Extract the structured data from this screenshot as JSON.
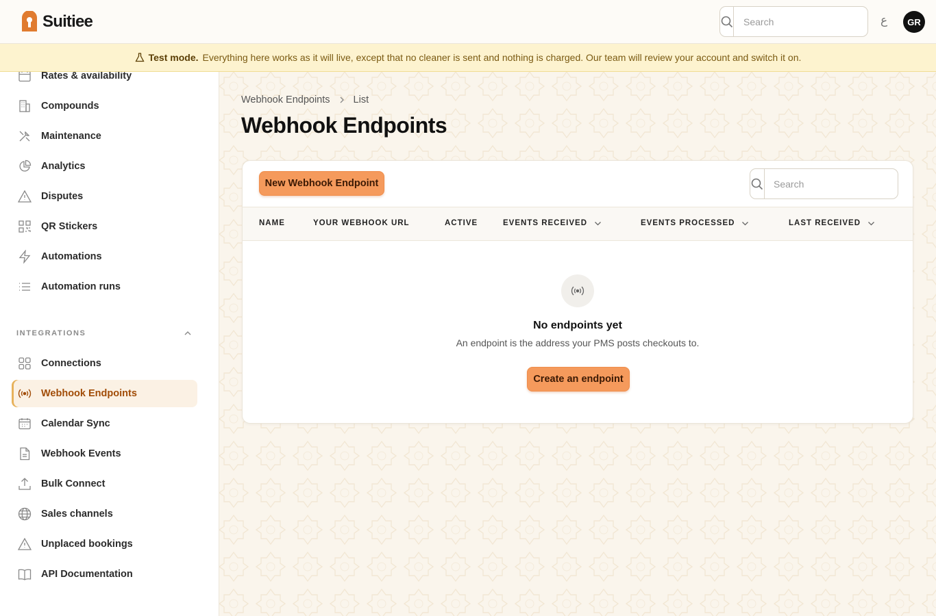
{
  "app": {
    "name": "Suitiee"
  },
  "topbar": {
    "search_placeholder": "Search",
    "lang_glyph": "ع",
    "avatar_initials": "GR"
  },
  "banner": {
    "label": "Test mode.",
    "message": "Everything here works as it will live, except that no cleaner is sent and nothing is charged. Our team will review your account and switch it on."
  },
  "sidebar": {
    "items_top": [
      {
        "label": "Rates & availability",
        "icon": "calendar-icon"
      },
      {
        "label": "Compounds",
        "icon": "building-icon"
      },
      {
        "label": "Maintenance",
        "icon": "tools-icon"
      },
      {
        "label": "Analytics",
        "icon": "pie-chart-icon"
      },
      {
        "label": "Disputes",
        "icon": "warning-icon"
      },
      {
        "label": "QR Stickers",
        "icon": "qr-code-icon"
      },
      {
        "label": "Automations",
        "icon": "bolt-icon"
      },
      {
        "label": "Automation runs",
        "icon": "list-icon"
      }
    ],
    "section_label": "INTEGRATIONS",
    "items_integrations": [
      {
        "label": "Connections",
        "icon": "grid-icon"
      },
      {
        "label": "Webhook Endpoints",
        "icon": "signal-icon",
        "active": true
      },
      {
        "label": "Calendar Sync",
        "icon": "calendar-icon"
      },
      {
        "label": "Webhook Events",
        "icon": "document-icon"
      },
      {
        "label": "Bulk Connect",
        "icon": "upload-icon"
      },
      {
        "label": "Sales channels",
        "icon": "globe-icon"
      },
      {
        "label": "Unplaced bookings",
        "icon": "warning-icon"
      },
      {
        "label": "API Documentation",
        "icon": "book-icon"
      }
    ]
  },
  "main": {
    "breadcrumb": [
      "Webhook Endpoints",
      "List"
    ],
    "title": "Webhook Endpoints",
    "new_button": "New Webhook Endpoint",
    "search_placeholder": "Search",
    "columns": [
      "NAME",
      "YOUR WEBHOOK URL",
      "ACTIVE",
      "EVENTS RECEIVED",
      "EVENTS PROCESSED",
      "LAST RECEIVED"
    ],
    "empty": {
      "title": "No endpoints yet",
      "description": "An endpoint is the address your PMS posts checkouts to.",
      "button": "Create an endpoint"
    }
  },
  "colors": {
    "accent": "#f59a5c",
    "active_text": "#a14c07",
    "banner_bg": "#fdf3cf"
  }
}
